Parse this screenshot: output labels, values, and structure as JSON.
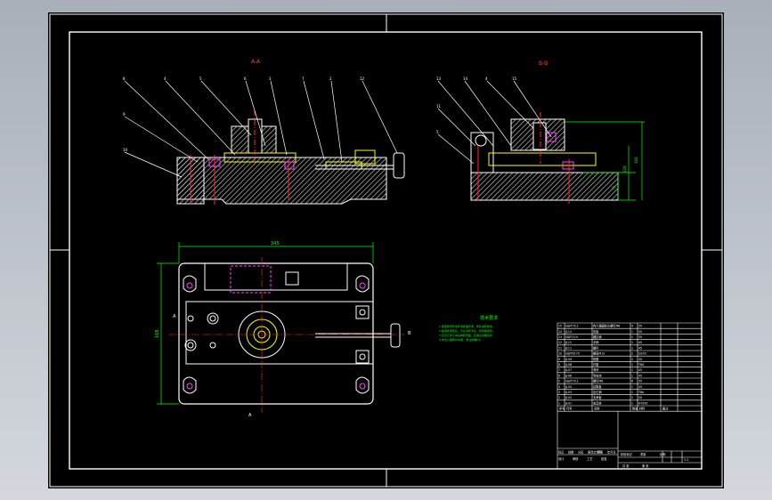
{
  "drawing": {
    "view_labels": {
      "section_a": "A-A",
      "section_b": "B-B",
      "mark_a_top": "A",
      "mark_a_bottom": "A",
      "mark_b": "B"
    },
    "balloons_left": [
      "8",
      "4",
      "5",
      "6",
      "3",
      "7",
      "2",
      "1",
      "12"
    ],
    "balloons_left_lower": [
      "9",
      "10"
    ],
    "balloons_right": [
      "13",
      "14",
      "4",
      "15",
      "11",
      "5"
    ],
    "dimensions": {
      "overall_width": "345",
      "overall_depth": "168",
      "height_total": "166",
      "height_mid": "128",
      "height_low": "75"
    },
    "notes_title": "技术要求",
    "notes": [
      "1.装配前所有零件用煤油清洗，铸件涂防锈漆。",
      "2.各零件装配后，不允许有卡住、松动等现象。",
      "3.定位元件与夹具体配合面，应保证接触良好，",
      "4.未注公差按IT12级，未注倒角C1。"
    ]
  },
  "title_block": {
    "header": [
      "序号",
      "代号",
      "名称",
      "数量",
      "材料",
      "备注"
    ],
    "rows": [
      [
        "15",
        "GB/T70.1",
        "内六角圆柱头螺钉M8",
        "4",
        "35",
        ""
      ],
      [
        "14",
        "JJ-14",
        "压板",
        "1",
        "45",
        ""
      ],
      [
        "13",
        "GB/T119",
        "圆柱销",
        "2",
        "35",
        ""
      ],
      [
        "12",
        "JJ-12",
        "手柄",
        "1",
        "45",
        ""
      ],
      [
        "11",
        "JJ-11",
        "螺杆",
        "1",
        "45",
        ""
      ],
      [
        "10",
        "GB/T6170",
        "螺母M12",
        "2",
        "Q235",
        ""
      ],
      [
        "9",
        "JJ-09",
        "垫圈",
        "2",
        "45",
        ""
      ],
      [
        "8",
        "JJ-08",
        "衬套",
        "1",
        "T8A",
        ""
      ],
      [
        "7",
        "JJ-07",
        "滑块",
        "1",
        "45",
        ""
      ],
      [
        "6",
        "JJ-06",
        "导向块",
        "1",
        "45",
        ""
      ],
      [
        "5",
        "GB/T70.1",
        "螺钉M6",
        "6",
        "35",
        ""
      ],
      [
        "4",
        "JJ-04",
        "钻模板",
        "1",
        "45",
        ""
      ],
      [
        "3",
        "JJ-03",
        "定位销",
        "1",
        "T8A",
        ""
      ],
      [
        "2",
        "JJ-02",
        "支承板",
        "2",
        "20",
        ""
      ],
      [
        "1",
        "JJ-01",
        "夹具体",
        "1",
        "HT200",
        ""
      ]
    ],
    "bottom_left": [
      "标记",
      "处数",
      "分区",
      "更改文件号",
      "签名",
      "年月日"
    ],
    "bottom_left2": [
      "设计",
      "审核",
      "工艺",
      "批准"
    ],
    "bottom_mid": [
      "阶段标记",
      "重量",
      "比例"
    ],
    "scale": "1:1",
    "sheet": [
      "共 张",
      "第 张"
    ]
  },
  "colors": {
    "background": "#000000",
    "frame": "#ffffff",
    "body": "#ffffff",
    "hatch": "#cccccc",
    "pin": "#ff2a2a",
    "hole": "#ff40ff",
    "centerline": "#ff3030",
    "detail": "#ffff00",
    "dimension": "#00ff00",
    "note_text": "#00ff00"
  }
}
